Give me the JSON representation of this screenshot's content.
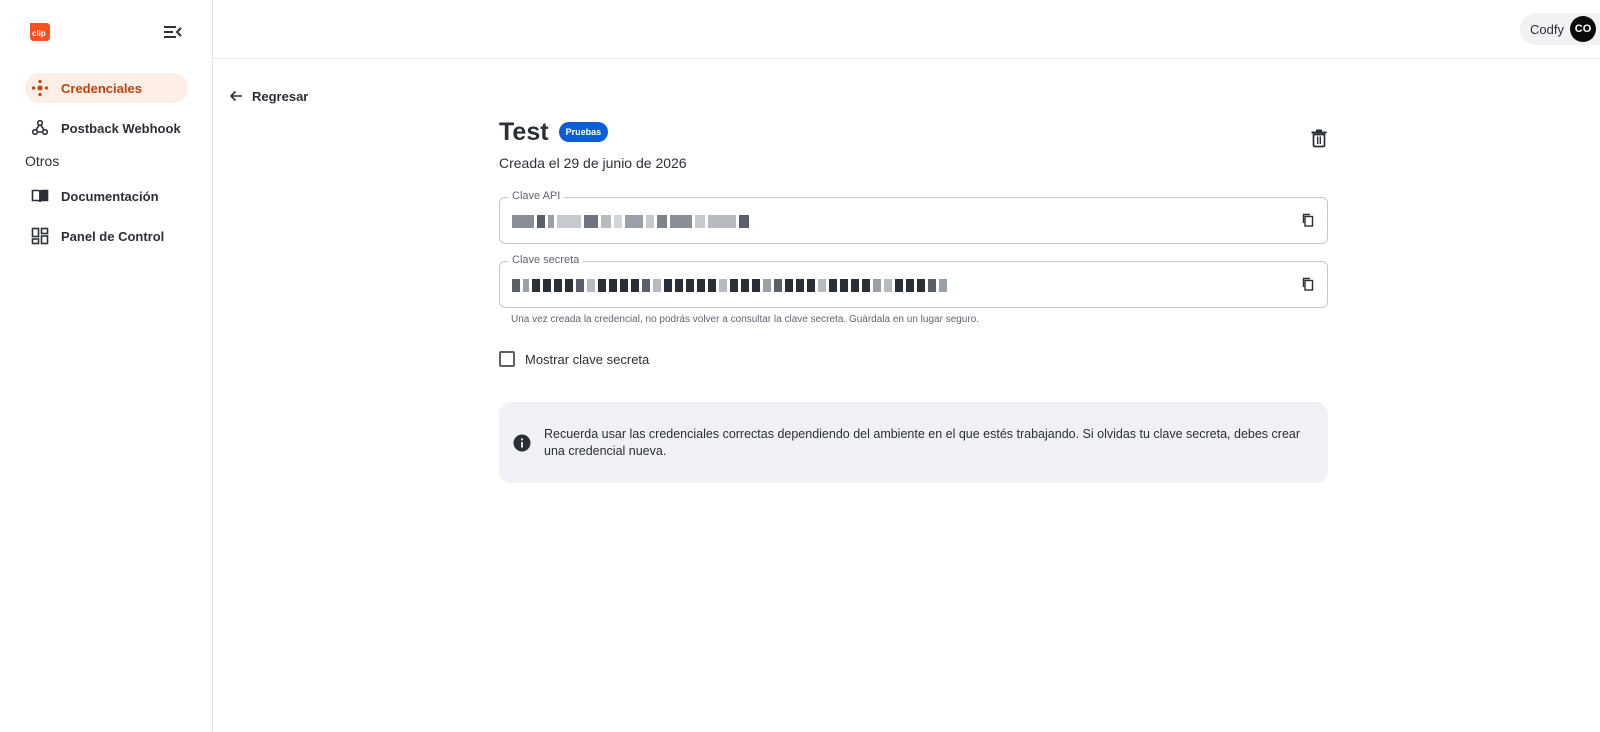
{
  "brand": {
    "logo_text": "clip",
    "accent_color": "#f4511e"
  },
  "sidebar": {
    "items": [
      {
        "label": "Credenciales",
        "icon": "credentials-icon",
        "active": true
      },
      {
        "label": "Postback Webhook",
        "icon": "webhook-icon",
        "active": false
      }
    ],
    "section_label": "Otros",
    "other_items": [
      {
        "label": "Documentación",
        "icon": "book-icon"
      },
      {
        "label": "Panel de Control",
        "icon": "dashboard-icon"
      }
    ]
  },
  "header": {
    "user_name": "Codfy",
    "avatar_initials": "CO"
  },
  "back": {
    "label": "Regresar"
  },
  "credential": {
    "title": "Test",
    "badge": "Pruebas",
    "created": "Creada el 29 de junio de 2026",
    "api_key_label": "Clave API",
    "secret_key_label": "Clave secreta",
    "helper_text": "Una vez creada la credencial, no podrás volver a consultar la clave secreta. Guárdala en un lugar seguro.",
    "show_secret_label": "Mostrar clave secreta",
    "show_secret_checked": false
  },
  "info": {
    "text": "Recuerda usar las credenciales correctas dependiendo del ambiente en el que estés trabajando. Si olvidas tu clave secreta, debes crear una credencial nueva."
  },
  "colors": {
    "active_bg": "#fdeee6",
    "active_text": "#c2410c",
    "badge_bg": "#0b5ed7",
    "info_bg": "#f0f1f4"
  }
}
